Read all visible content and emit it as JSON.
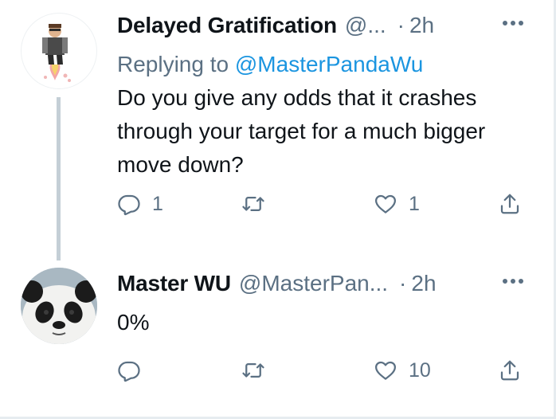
{
  "tweets": [
    {
      "name": "Delayed Gratification",
      "handle": "@...",
      "separator": "·",
      "time": "2h",
      "replying_prefix": "Replying to",
      "replying_to": "@MasterPandaWu",
      "text": "Do you give any odds that it crashes through your target for a much bigger move down?",
      "reply_count": "1",
      "retweet_count": "",
      "like_count": "1",
      "avatar_icon": "jetpack-cartoon-avatar"
    },
    {
      "name": "Master WU",
      "handle": "@MasterPan...",
      "separator": "·",
      "time": "2h",
      "text": "0%",
      "reply_count": "",
      "retweet_count": "",
      "like_count": "10",
      "avatar_icon": "panda-avatar"
    }
  ],
  "colors": {
    "text": "#0f1419",
    "secondary": "#5b7083",
    "link": "#1b95e0",
    "thread_line": "#c4cfd6",
    "border": "#e6ecf0"
  },
  "icons": {
    "reply": "reply-icon",
    "retweet": "retweet-icon",
    "like": "heart-icon",
    "share": "share-icon",
    "more": "more-dots-icon"
  }
}
